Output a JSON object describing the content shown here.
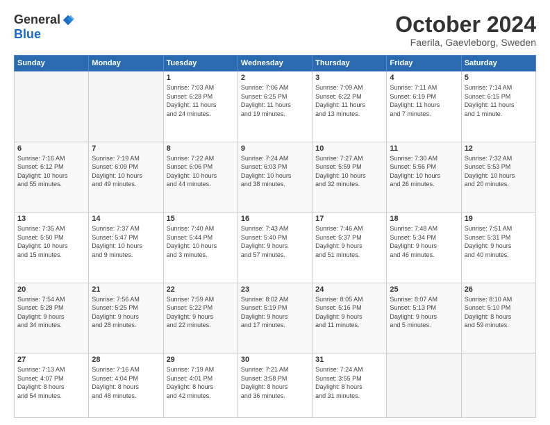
{
  "header": {
    "logo_general": "General",
    "logo_blue": "Blue",
    "month": "October 2024",
    "location": "Faerila, Gaevleborg, Sweden"
  },
  "days_of_week": [
    "Sunday",
    "Monday",
    "Tuesday",
    "Wednesday",
    "Thursday",
    "Friday",
    "Saturday"
  ],
  "weeks": [
    [
      {
        "num": "",
        "info": ""
      },
      {
        "num": "",
        "info": ""
      },
      {
        "num": "1",
        "info": "Sunrise: 7:03 AM\nSunset: 6:28 PM\nDaylight: 11 hours\nand 24 minutes."
      },
      {
        "num": "2",
        "info": "Sunrise: 7:06 AM\nSunset: 6:25 PM\nDaylight: 11 hours\nand 19 minutes."
      },
      {
        "num": "3",
        "info": "Sunrise: 7:09 AM\nSunset: 6:22 PM\nDaylight: 11 hours\nand 13 minutes."
      },
      {
        "num": "4",
        "info": "Sunrise: 7:11 AM\nSunset: 6:19 PM\nDaylight: 11 hours\nand 7 minutes."
      },
      {
        "num": "5",
        "info": "Sunrise: 7:14 AM\nSunset: 6:15 PM\nDaylight: 11 hours\nand 1 minute."
      }
    ],
    [
      {
        "num": "6",
        "info": "Sunrise: 7:16 AM\nSunset: 6:12 PM\nDaylight: 10 hours\nand 55 minutes."
      },
      {
        "num": "7",
        "info": "Sunrise: 7:19 AM\nSunset: 6:09 PM\nDaylight: 10 hours\nand 49 minutes."
      },
      {
        "num": "8",
        "info": "Sunrise: 7:22 AM\nSunset: 6:06 PM\nDaylight: 10 hours\nand 44 minutes."
      },
      {
        "num": "9",
        "info": "Sunrise: 7:24 AM\nSunset: 6:03 PM\nDaylight: 10 hours\nand 38 minutes."
      },
      {
        "num": "10",
        "info": "Sunrise: 7:27 AM\nSunset: 5:59 PM\nDaylight: 10 hours\nand 32 minutes."
      },
      {
        "num": "11",
        "info": "Sunrise: 7:30 AM\nSunset: 5:56 PM\nDaylight: 10 hours\nand 26 minutes."
      },
      {
        "num": "12",
        "info": "Sunrise: 7:32 AM\nSunset: 5:53 PM\nDaylight: 10 hours\nand 20 minutes."
      }
    ],
    [
      {
        "num": "13",
        "info": "Sunrise: 7:35 AM\nSunset: 5:50 PM\nDaylight: 10 hours\nand 15 minutes."
      },
      {
        "num": "14",
        "info": "Sunrise: 7:37 AM\nSunset: 5:47 PM\nDaylight: 10 hours\nand 9 minutes."
      },
      {
        "num": "15",
        "info": "Sunrise: 7:40 AM\nSunset: 5:44 PM\nDaylight: 10 hours\nand 3 minutes."
      },
      {
        "num": "16",
        "info": "Sunrise: 7:43 AM\nSunset: 5:40 PM\nDaylight: 9 hours\nand 57 minutes."
      },
      {
        "num": "17",
        "info": "Sunrise: 7:46 AM\nSunset: 5:37 PM\nDaylight: 9 hours\nand 51 minutes."
      },
      {
        "num": "18",
        "info": "Sunrise: 7:48 AM\nSunset: 5:34 PM\nDaylight: 9 hours\nand 46 minutes."
      },
      {
        "num": "19",
        "info": "Sunrise: 7:51 AM\nSunset: 5:31 PM\nDaylight: 9 hours\nand 40 minutes."
      }
    ],
    [
      {
        "num": "20",
        "info": "Sunrise: 7:54 AM\nSunset: 5:28 PM\nDaylight: 9 hours\nand 34 minutes."
      },
      {
        "num": "21",
        "info": "Sunrise: 7:56 AM\nSunset: 5:25 PM\nDaylight: 9 hours\nand 28 minutes."
      },
      {
        "num": "22",
        "info": "Sunrise: 7:59 AM\nSunset: 5:22 PM\nDaylight: 9 hours\nand 22 minutes."
      },
      {
        "num": "23",
        "info": "Sunrise: 8:02 AM\nSunset: 5:19 PM\nDaylight: 9 hours\nand 17 minutes."
      },
      {
        "num": "24",
        "info": "Sunrise: 8:05 AM\nSunset: 5:16 PM\nDaylight: 9 hours\nand 11 minutes."
      },
      {
        "num": "25",
        "info": "Sunrise: 8:07 AM\nSunset: 5:13 PM\nDaylight: 9 hours\nand 5 minutes."
      },
      {
        "num": "26",
        "info": "Sunrise: 8:10 AM\nSunset: 5:10 PM\nDaylight: 8 hours\nand 59 minutes."
      }
    ],
    [
      {
        "num": "27",
        "info": "Sunrise: 7:13 AM\nSunset: 4:07 PM\nDaylight: 8 hours\nand 54 minutes."
      },
      {
        "num": "28",
        "info": "Sunrise: 7:16 AM\nSunset: 4:04 PM\nDaylight: 8 hours\nand 48 minutes."
      },
      {
        "num": "29",
        "info": "Sunrise: 7:19 AM\nSunset: 4:01 PM\nDaylight: 8 hours\nand 42 minutes."
      },
      {
        "num": "30",
        "info": "Sunrise: 7:21 AM\nSunset: 3:58 PM\nDaylight: 8 hours\nand 36 minutes."
      },
      {
        "num": "31",
        "info": "Sunrise: 7:24 AM\nSunset: 3:55 PM\nDaylight: 8 hours\nand 31 minutes."
      },
      {
        "num": "",
        "info": ""
      },
      {
        "num": "",
        "info": ""
      }
    ]
  ]
}
